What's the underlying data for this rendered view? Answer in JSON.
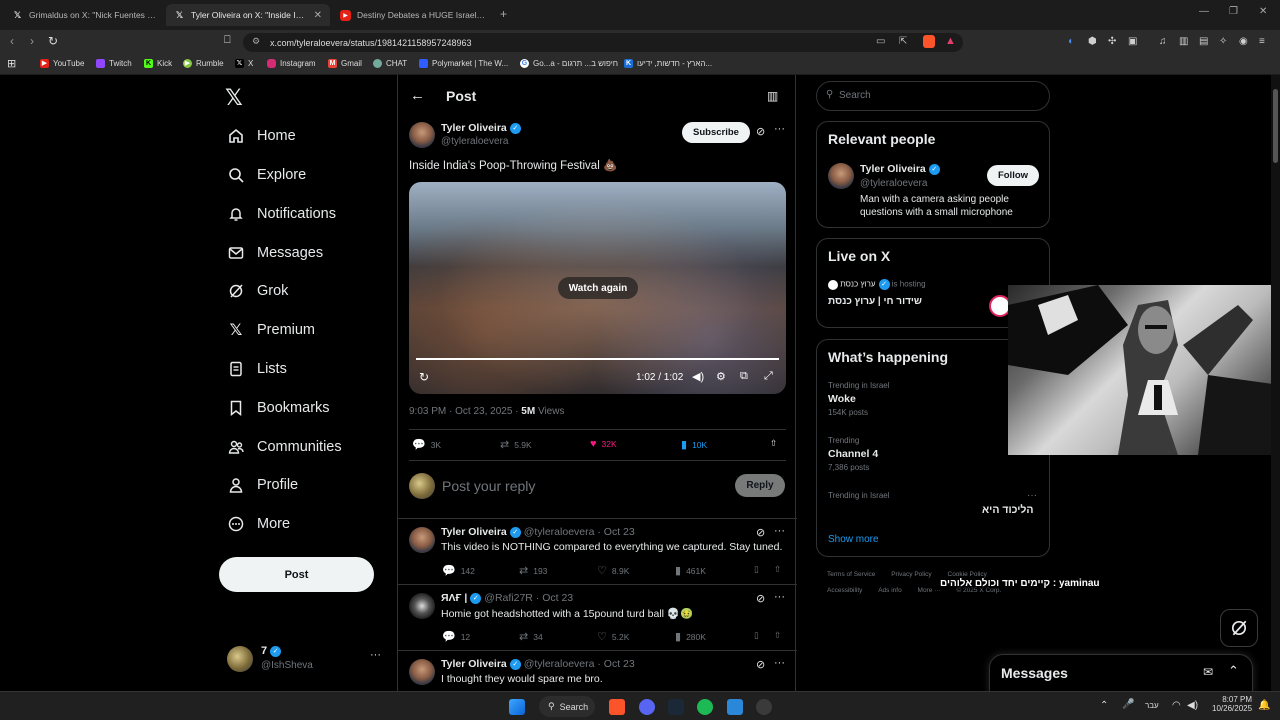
{
  "browser": {
    "tabs": [
      {
        "label": "Grimaldus on X: \"Nick Fuentes says",
        "icon": "x-logo-icon",
        "active": false
      },
      {
        "label": "Tyler Oliveira on X: \"Inside India",
        "icon": "x-logo-icon",
        "active": true
      },
      {
        "label": "Destiny Debates a HUGE Israeli Cont",
        "icon": "youtube-icon",
        "active": false
      }
    ],
    "new_tab": "+",
    "url": "x.com/tyleraloevera/status/1981421158957248963",
    "bookmarks": [
      {
        "label": "YouTube",
        "color": "#e62117"
      },
      {
        "label": "Twitch",
        "color": "#9146ff"
      },
      {
        "label": "Kick",
        "color": "#53fc18"
      },
      {
        "label": "Rumble",
        "color": "#85c742"
      },
      {
        "label": "X",
        "color": "#000000"
      },
      {
        "label": "Instagram",
        "color": "#d62976"
      },
      {
        "label": "Gmail",
        "color": "#ea4335"
      },
      {
        "label": "CHAT",
        "color": "#74aa9c"
      },
      {
        "label": "Polymarket | The W...",
        "color": "#2e5cff"
      },
      {
        "label": "Go...a - חיפוש ב... תרגום",
        "color": "#4285f4"
      },
      {
        "label": "הארץ - חדשות, ידיעו...",
        "color": "#1a6dd6"
      }
    ]
  },
  "sidebar": {
    "items": [
      {
        "label": "Home",
        "icon": "home-icon"
      },
      {
        "label": "Explore",
        "icon": "search-icon"
      },
      {
        "label": "Notifications",
        "icon": "bell-icon"
      },
      {
        "label": "Messages",
        "icon": "mail-icon"
      },
      {
        "label": "Grok",
        "icon": "grok-icon"
      },
      {
        "label": "Premium",
        "icon": "x-logo-icon"
      },
      {
        "label": "Lists",
        "icon": "list-icon"
      },
      {
        "label": "Bookmarks",
        "icon": "bookmark-icon"
      },
      {
        "label": "Communities",
        "icon": "people-icon"
      },
      {
        "label": "Profile",
        "icon": "person-icon"
      },
      {
        "label": "More",
        "icon": "more-circle-icon"
      }
    ],
    "post_button": "Post",
    "account": {
      "name": "7",
      "handle": "@IshSheva",
      "more": "···"
    }
  },
  "main": {
    "header_title": "Post",
    "tweet": {
      "author_name": "Tyler Oliveira",
      "author_handle": "@tyleraloevera",
      "subscribe_label": "Subscribe",
      "text": "Inside India's Poop-Throwing Festival 💩",
      "video": {
        "overlay_label": "Watch again",
        "time": "1:02 / 1:02",
        "progress": 1.0
      },
      "meta_time": "9:03 PM · Oct 23, 2025 · ",
      "meta_views_number": "5M",
      "meta_views_label": " Views",
      "stats": {
        "replies": "3K",
        "reposts": "5.9K",
        "likes": "32K",
        "bookmarks": "10K"
      }
    },
    "reply_composer": {
      "placeholder": "Post your reply",
      "reply_button": "Reply"
    },
    "replies": [
      {
        "name": "Tyler Oliveira",
        "handle": "@tyleraloevera · Oct 23",
        "text": "This video is NOTHING compared to everything we captured. Stay tuned.",
        "replies": "142",
        "reposts": "193",
        "likes": "8.9K",
        "views": "461K"
      },
      {
        "name": "ЯΛҒ |",
        "handle": "@Rafi27R · Oct 23",
        "text": "Homie got headshotted with a 15pound turd ball 💀🤢",
        "replies": "12",
        "reposts": "34",
        "likes": "5.2K",
        "views": "280K"
      },
      {
        "name": "Tyler Oliveira",
        "handle": "@tyleraloevera · Oct 23",
        "text": "I thought they would spare me bro."
      }
    ]
  },
  "right": {
    "search_placeholder": "Search",
    "relevant": {
      "title": "Relevant people",
      "name": "Tyler Oliveira",
      "handle": "@tyleraloevera",
      "follow_label": "Follow",
      "bio": "Man with a camera asking people questions with a small microphone"
    },
    "live": {
      "title": "Live on X",
      "host": "ערוץ כנסת",
      "hosting_label": "is hosting",
      "show": "שידור חי | ערוץ כנסת"
    },
    "happening": {
      "title": "What’s happening",
      "trends": [
        {
          "category": "Trending in Israel",
          "name": "Woke",
          "count": "154K posts"
        },
        {
          "category": "Trending",
          "name": "Channel 4",
          "count": "7,386 posts"
        },
        {
          "category": "Trending in Israel",
          "name": "הליכוד היא",
          "count": ""
        }
      ],
      "show_more": "Show more"
    },
    "footer": [
      "Terms of Service",
      "Privacy Policy",
      "Cookie Policy",
      "Accessibility",
      "Ads info",
      "More ···",
      "© 2025 X Corp."
    ],
    "overlay_caption": "קיימים יחד וכולם אלוהים : yaminau"
  },
  "messages_drawer": {
    "title": "Messages"
  },
  "taskbar": {
    "search_label": "Search",
    "language": "עבר",
    "time": "8:07 PM",
    "date": "10/26/2025"
  },
  "colors": {
    "like": "#f91880",
    "bookmark": "#1d9bf0",
    "verified": "#1d9bf0"
  }
}
